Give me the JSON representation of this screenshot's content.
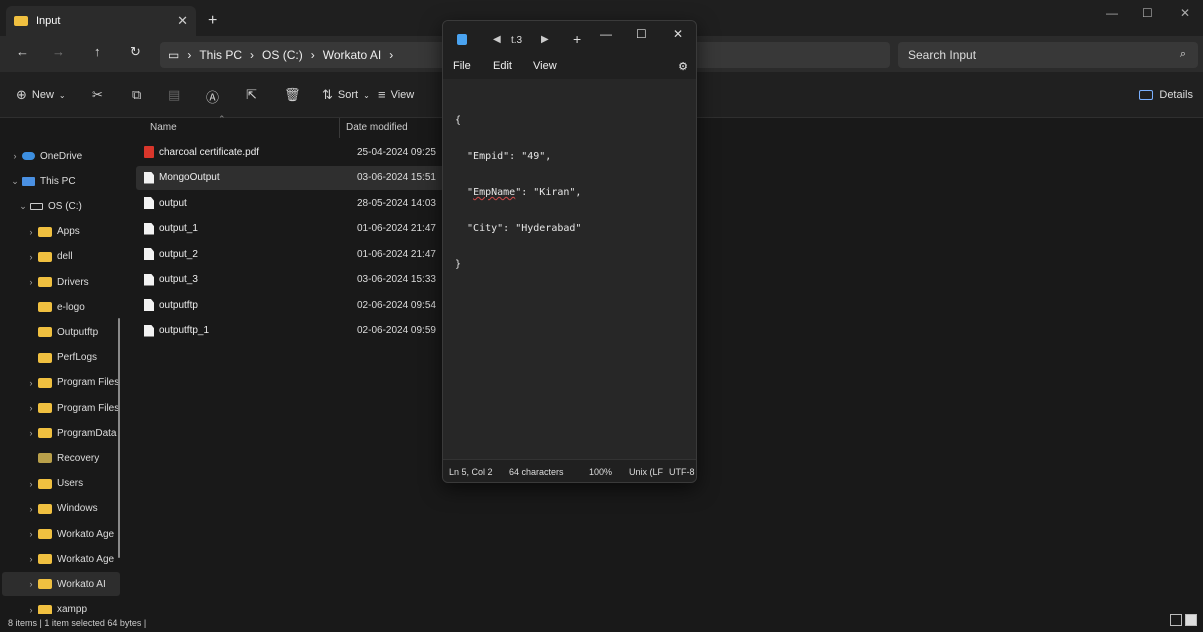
{
  "explorer": {
    "tab_title": "Input",
    "address": [
      "This PC",
      "OS (C:)",
      "Workato AI"
    ],
    "search_placeholder": "Search Input",
    "commands": {
      "new": "New",
      "sort": "Sort",
      "view": "View",
      "details": "Details"
    },
    "columns": {
      "name": "Name",
      "date": "Date modified"
    },
    "files": [
      {
        "name": "charcoal certificate.pdf",
        "date": "25-04-2024 09:25",
        "icon": "pdf-file-icon"
      },
      {
        "name": "MongoOutput",
        "date": "03-06-2024 15:51",
        "icon": "file-icon",
        "selected": true
      },
      {
        "name": "output",
        "date": "28-05-2024 14:03",
        "icon": "file-icon"
      },
      {
        "name": "output_1",
        "date": "01-06-2024 21:47",
        "icon": "file-icon"
      },
      {
        "name": "output_2",
        "date": "01-06-2024 21:47",
        "icon": "file-icon"
      },
      {
        "name": "output_3",
        "date": "03-06-2024 15:33",
        "icon": "file-icon"
      },
      {
        "name": "outputftp",
        "date": "02-06-2024 09:54",
        "icon": "file-icon"
      },
      {
        "name": "outputftp_1",
        "date": "02-06-2024 09:59",
        "icon": "file-icon"
      }
    ],
    "sidebar": [
      {
        "label": "OneDrive",
        "icon": "cloud-icon",
        "chevron": ">"
      },
      {
        "label": "This PC",
        "icon": "pc-icon",
        "chevron": "v"
      },
      {
        "label": "OS (C:)",
        "icon": "drive-icon",
        "chevron": "v"
      },
      {
        "label": "Apps",
        "icon": "folder-icon",
        "chevron": ">"
      },
      {
        "label": "dell",
        "icon": "folder-icon",
        "chevron": ">"
      },
      {
        "label": "Drivers",
        "icon": "folder-icon",
        "chevron": ">"
      },
      {
        "label": "e-logo",
        "icon": "folder-icon",
        "chevron": ""
      },
      {
        "label": "Outputftp",
        "icon": "folder-icon",
        "chevron": ""
      },
      {
        "label": "PerfLogs",
        "icon": "folder-icon",
        "chevron": ""
      },
      {
        "label": "Program Files",
        "icon": "folder-icon",
        "chevron": ">"
      },
      {
        "label": "Program Files",
        "icon": "folder-icon",
        "chevron": ">"
      },
      {
        "label": "ProgramData",
        "icon": "folder-icon",
        "chevron": ">"
      },
      {
        "label": "Recovery",
        "icon": "folder-icon",
        "chevron": ""
      },
      {
        "label": "Users",
        "icon": "folder-icon",
        "chevron": ">"
      },
      {
        "label": "Windows",
        "icon": "folder-icon",
        "chevron": ">"
      },
      {
        "label": "Workato Age",
        "icon": "folder-icon",
        "chevron": ">"
      },
      {
        "label": "Workato Age",
        "icon": "folder-icon",
        "chevron": ">"
      },
      {
        "label": "Workato AI",
        "icon": "folder-icon",
        "chevron": ">",
        "selected": true
      },
      {
        "label": "xampp",
        "icon": "folder-icon",
        "chevron": ">"
      }
    ],
    "status": "8 items  |  1 item selected  64 bytes  |"
  },
  "notepad": {
    "tab_title": "t.3",
    "menu": [
      "File",
      "Edit",
      "View"
    ],
    "content_lines": [
      "{",
      "  \"Empid\": \"49\",",
      "  \"EmpName\": \"Kiran\",",
      "  \"City\": \"Hyderabad\"",
      "}"
    ],
    "status": {
      "position": "Ln 5, Col 2",
      "chars": "64 characters",
      "zoom": "100%",
      "eol": "Unix (LF)",
      "encoding": "UTF-8"
    }
  }
}
